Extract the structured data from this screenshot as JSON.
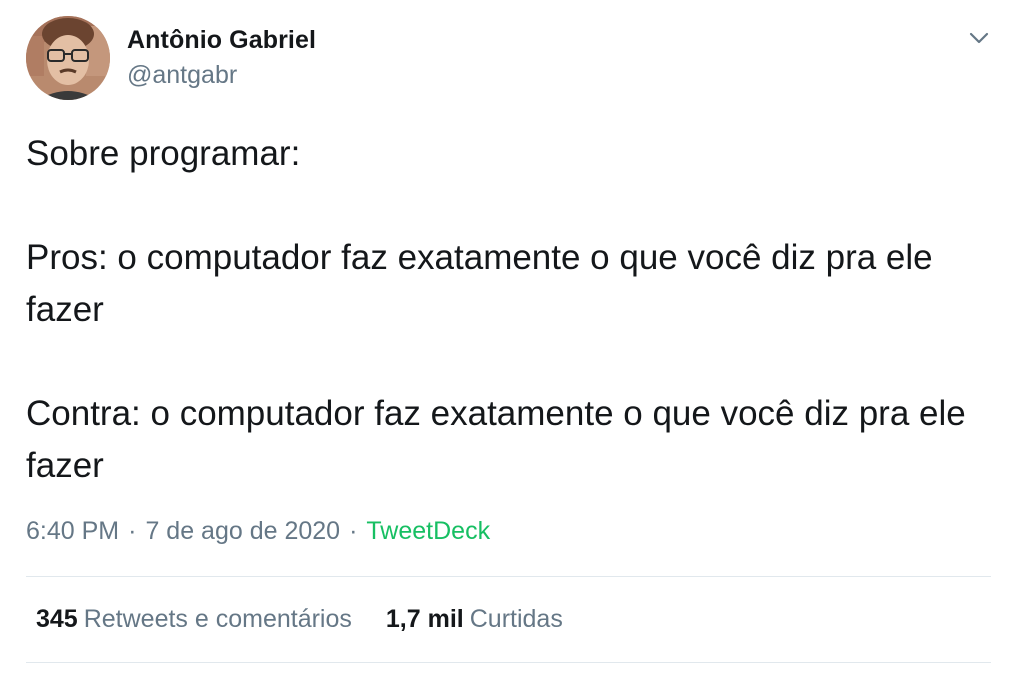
{
  "author": {
    "display_name": "Antônio Gabriel",
    "handle": "@antgabr",
    "avatar_icon": "user-avatar-photo"
  },
  "menu": {
    "icon": "chevron-down-icon"
  },
  "tweet": {
    "text": "Sobre programar:\n\nPros: o computador faz exatamente o que você diz pra ele fazer\n\nContra: o computador faz exatamente o que você diz pra ele fazer"
  },
  "meta": {
    "time": "6:40 PM",
    "separator": "·",
    "date": "7 de ago de 2020",
    "source": "TweetDeck"
  },
  "stats": {
    "retweets": {
      "count": "345",
      "label": "Retweets e comentários"
    },
    "likes": {
      "count": "1,7 mil",
      "label": "Curtidas"
    }
  },
  "colors": {
    "text_primary": "#14171a",
    "text_secondary": "#657786",
    "source_link": "#17bf63",
    "divider": "#e1e8ed"
  }
}
